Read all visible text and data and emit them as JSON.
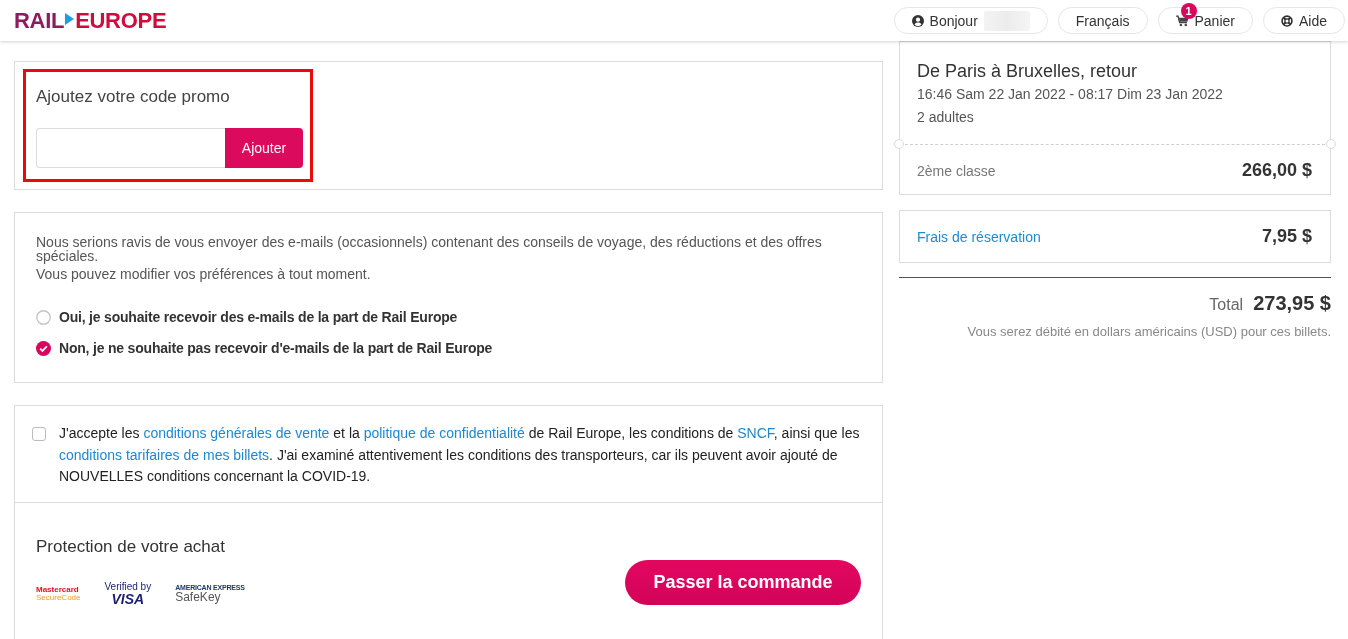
{
  "header": {
    "logo": {
      "left": "RAIL",
      "right": "EUROPE"
    },
    "nav": [
      {
        "kind": "account",
        "label": "Bonjour",
        "redacted": true
      },
      {
        "kind": "language",
        "label": "Français"
      },
      {
        "kind": "cart",
        "label": "Panier",
        "badge": "1"
      },
      {
        "kind": "help",
        "label": "Aide"
      }
    ]
  },
  "promo": {
    "title": "Ajoutez votre code promo",
    "button": "Ajouter",
    "highlighted": true
  },
  "newsletter": {
    "text": "Nous serions ravis de vous envoyer des e-mails (occasionnels) contenant des conseils de voyage, des réductions et des offres spéciales.",
    "note": "Vous pouvez modifier vos préférences à tout moment.",
    "options": [
      {
        "label": "Oui, je souhaite recevoir des e-mails de la part de Rail Europe",
        "selected": false
      },
      {
        "label": "Non, je ne souhaite pas recevoir d'e-mails de la part de Rail Europe",
        "selected": true
      }
    ]
  },
  "terms": {
    "checked": false,
    "parts": [
      {
        "kind": "text",
        "text": "J'accepte les "
      },
      {
        "kind": "link",
        "text": "conditions générales de vente"
      },
      {
        "kind": "text",
        "text": " et la "
      },
      {
        "kind": "link",
        "text": "politique de confidentialité"
      },
      {
        "kind": "text",
        "text": " de Rail Europe, les conditions de "
      },
      {
        "kind": "link",
        "text": "SNCF"
      },
      {
        "kind": "text",
        "text": ", ainsi que les "
      },
      {
        "kind": "link",
        "text": "conditions tarifaires de mes billets"
      },
      {
        "kind": "text",
        "text": ". J'ai examiné attentivement les conditions des transporteurs, car ils peuvent avoir ajouté de NOUVELLES conditions concernant la COVID-19."
      }
    ]
  },
  "protection": {
    "title": "Protection de votre achat",
    "badges": [
      {
        "kind": "mastercard",
        "lines": [
          "Mastercard",
          "SecureCode"
        ]
      },
      {
        "kind": "visa",
        "lines": [
          "Verified by",
          "VISA"
        ]
      },
      {
        "kind": "amex",
        "lines": [
          "AMERICAN EXPRESS",
          "SafeKey"
        ]
      }
    ],
    "order_button": "Passer la commande"
  },
  "summary": {
    "trip": {
      "title": "De Paris à Bruxelles, retour",
      "dates": "16:46 Sam 22 Jan 2022 - 08:17 Dim 23 Jan 2022",
      "passengers": "2 adultes",
      "class": "2ème classe",
      "price": "266,00 $"
    },
    "fee": {
      "label": "Frais de réservation",
      "price": "7,95 $"
    },
    "total": {
      "label": "Total",
      "price": "273,95 $"
    },
    "note": "Vous serez débité en dollars américains (USD) pour ces billets."
  }
}
